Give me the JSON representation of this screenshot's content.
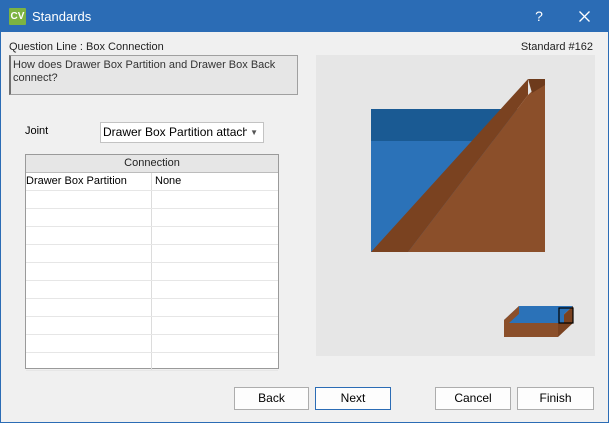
{
  "window": {
    "app_icon_text": "CV",
    "title": "Standards",
    "help_label": "?"
  },
  "question": {
    "line_label": "Question Line : Box Connection",
    "standard_label": "Standard #162",
    "text": "How does Drawer Box Partition and Drawer Box Back connect?"
  },
  "joint": {
    "label": "Joint",
    "selected": "Drawer Box Partition attaches"
  },
  "grid": {
    "header": "Connection",
    "rows": [
      {
        "name": "Drawer Box Partition",
        "value": "None"
      }
    ]
  },
  "preview": {
    "colors": {
      "blue": "#2b72b8",
      "blue_dark": "#1a5a93",
      "brown": "#8b4f2a",
      "brown_dark": "#7a4220"
    }
  },
  "buttons": {
    "back": "Back",
    "next": "Next",
    "cancel": "Cancel",
    "finish": "Finish"
  }
}
